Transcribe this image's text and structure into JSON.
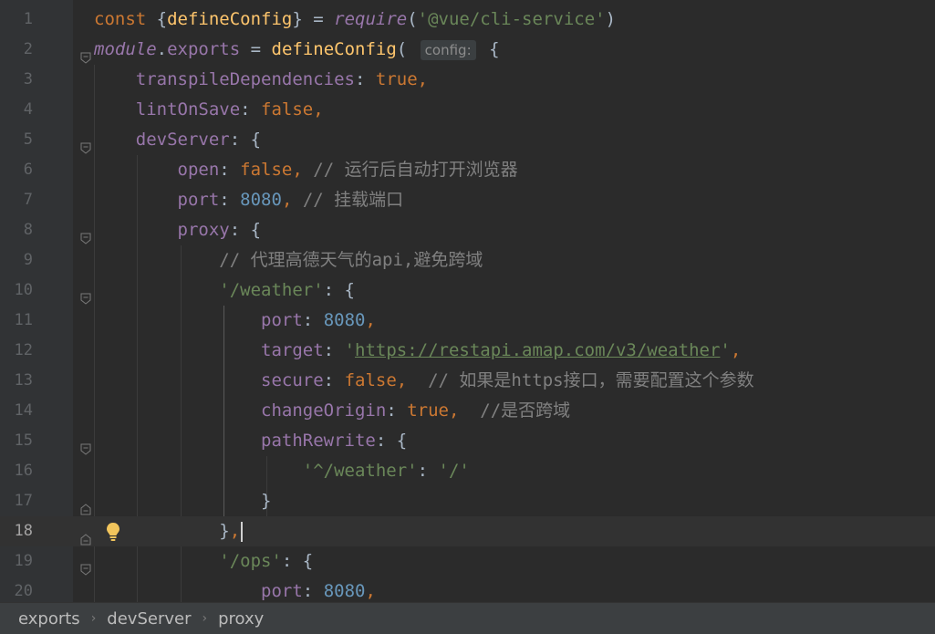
{
  "editor": {
    "current_line": 18,
    "lines": [
      {
        "n": "1",
        "tokens": [
          {
            "c": "kw",
            "t": "const "
          },
          {
            "c": "",
            "t": "{"
          },
          {
            "c": "fn",
            "t": "defineConfig"
          },
          {
            "c": "",
            "t": "} = "
          },
          {
            "c": "it",
            "t": "require"
          },
          {
            "c": "",
            "t": "("
          },
          {
            "c": "str",
            "t": "'@vue/cli-service'"
          },
          {
            "c": "",
            "t": ")"
          }
        ]
      },
      {
        "n": "2",
        "tokens": [
          {
            "c": "it",
            "t": "module"
          },
          {
            "c": "",
            "t": "."
          },
          {
            "c": "prop",
            "t": "exports"
          },
          {
            "c": "",
            "t": " = "
          },
          {
            "c": "fn",
            "t": "defineConfig"
          },
          {
            "c": "",
            "t": "( "
          },
          {
            "c": "hint",
            "t": "config:"
          },
          {
            "c": "",
            "t": " {"
          }
        ]
      },
      {
        "n": "3",
        "tokens": [
          {
            "c": "",
            "t": "    "
          },
          {
            "c": "prop",
            "t": "transpileDependencies"
          },
          {
            "c": "",
            "t": ": "
          },
          {
            "c": "kw",
            "t": "true,"
          }
        ]
      },
      {
        "n": "4",
        "tokens": [
          {
            "c": "",
            "t": "    "
          },
          {
            "c": "prop",
            "t": "lintOnSave"
          },
          {
            "c": "",
            "t": ": "
          },
          {
            "c": "kw",
            "t": "false,"
          }
        ]
      },
      {
        "n": "5",
        "tokens": [
          {
            "c": "",
            "t": "    "
          },
          {
            "c": "prop",
            "t": "devServer"
          },
          {
            "c": "",
            "t": ": {"
          }
        ]
      },
      {
        "n": "6",
        "tokens": [
          {
            "c": "",
            "t": "        "
          },
          {
            "c": "prop",
            "t": "open"
          },
          {
            "c": "",
            "t": ": "
          },
          {
            "c": "kw",
            "t": "false,"
          },
          {
            "c": "cmt",
            "t": " // 运行后自动打开浏览器"
          }
        ]
      },
      {
        "n": "7",
        "tokens": [
          {
            "c": "",
            "t": "        "
          },
          {
            "c": "prop",
            "t": "port"
          },
          {
            "c": "",
            "t": ": "
          },
          {
            "c": "num",
            "t": "8080"
          },
          {
            "c": "kw",
            "t": ","
          },
          {
            "c": "cmt",
            "t": " // 挂载端口"
          }
        ]
      },
      {
        "n": "8",
        "tokens": [
          {
            "c": "",
            "t": "        "
          },
          {
            "c": "prop",
            "t": "proxy"
          },
          {
            "c": "",
            "t": ": {"
          }
        ]
      },
      {
        "n": "9",
        "tokens": [
          {
            "c": "",
            "t": "            "
          },
          {
            "c": "cmt",
            "t": "// 代理高德天气的api,避免跨域"
          }
        ]
      },
      {
        "n": "10",
        "tokens": [
          {
            "c": "",
            "t": "            "
          },
          {
            "c": "str",
            "t": "'/weather'"
          },
          {
            "c": "",
            "t": ": {"
          }
        ]
      },
      {
        "n": "11",
        "tokens": [
          {
            "c": "",
            "t": "                "
          },
          {
            "c": "prop",
            "t": "port"
          },
          {
            "c": "",
            "t": ": "
          },
          {
            "c": "num",
            "t": "8080"
          },
          {
            "c": "kw",
            "t": ","
          }
        ]
      },
      {
        "n": "12",
        "tokens": [
          {
            "c": "",
            "t": "                "
          },
          {
            "c": "prop",
            "t": "target"
          },
          {
            "c": "",
            "t": ": "
          },
          {
            "c": "str",
            "t": "'"
          },
          {
            "c": "url",
            "t": "https://restapi.amap.com/v3/weather"
          },
          {
            "c": "str",
            "t": "'"
          },
          {
            "c": "kw",
            "t": ","
          }
        ]
      },
      {
        "n": "13",
        "tokens": [
          {
            "c": "",
            "t": "                "
          },
          {
            "c": "prop",
            "t": "secure"
          },
          {
            "c": "",
            "t": ": "
          },
          {
            "c": "kw",
            "t": "false,"
          },
          {
            "c": "cmt",
            "t": "  // 如果是https接口，需要配置这个参数"
          }
        ]
      },
      {
        "n": "14",
        "tokens": [
          {
            "c": "",
            "t": "                "
          },
          {
            "c": "prop",
            "t": "changeOrigin"
          },
          {
            "c": "",
            "t": ": "
          },
          {
            "c": "kw",
            "t": "true,"
          },
          {
            "c": "cmt",
            "t": "  //是否跨域"
          }
        ]
      },
      {
        "n": "15",
        "tokens": [
          {
            "c": "",
            "t": "                "
          },
          {
            "c": "prop",
            "t": "pathRewrite"
          },
          {
            "c": "",
            "t": ": {"
          }
        ]
      },
      {
        "n": "16",
        "tokens": [
          {
            "c": "",
            "t": "                    "
          },
          {
            "c": "str",
            "t": "'^/weather'"
          },
          {
            "c": "",
            "t": ": "
          },
          {
            "c": "str",
            "t": "'/'"
          }
        ]
      },
      {
        "n": "17",
        "tokens": [
          {
            "c": "",
            "t": "                "
          },
          {
            "c": "",
            "t": "}"
          }
        ]
      },
      {
        "n": "18",
        "tokens": [
          {
            "c": "",
            "t": "            "
          },
          {
            "c": "",
            "t": "}"
          },
          {
            "c": "kw",
            "t": ","
          }
        ]
      },
      {
        "n": "19",
        "tokens": [
          {
            "c": "",
            "t": "            "
          },
          {
            "c": "str",
            "t": "'/ops'"
          },
          {
            "c": "",
            "t": ": {"
          }
        ]
      },
      {
        "n": "20",
        "tokens": [
          {
            "c": "",
            "t": "                "
          },
          {
            "c": "prop",
            "t": "port"
          },
          {
            "c": "",
            "t": ": "
          },
          {
            "c": "num",
            "t": "8080"
          },
          {
            "c": "kw",
            "t": ","
          }
        ]
      }
    ]
  },
  "breadcrumb": {
    "items": [
      "exports",
      "devServer",
      "proxy"
    ]
  },
  "colors": {
    "background": "#2b2b2b",
    "keyword": "#cc7832",
    "function": "#ffc66d",
    "property": "#9876aa",
    "string": "#6a8759",
    "number": "#6897bb",
    "comment": "#808080"
  }
}
